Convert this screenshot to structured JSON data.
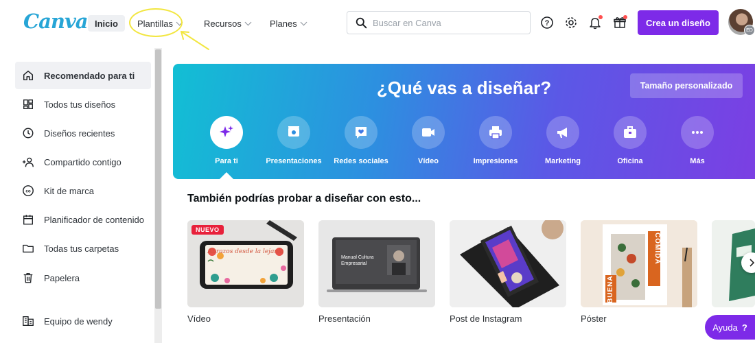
{
  "header": {
    "logo": "Canva",
    "nav": [
      {
        "label": "Inicio"
      },
      {
        "label": "Plantillas"
      },
      {
        "label": "Recursos"
      },
      {
        "label": "Planes"
      }
    ],
    "search_placeholder": "Buscar en Canva",
    "create_label": "Crea un diseño",
    "avatar_initials": "ED",
    "icons": [
      "help-icon",
      "settings-icon",
      "notification-bell-icon",
      "gift-icon"
    ]
  },
  "sidebar": {
    "items": [
      {
        "label": "Recomendado para ti",
        "icon": "home-icon"
      },
      {
        "label": "Todos tus diseños",
        "icon": "grid-icon"
      },
      {
        "label": "Diseños recientes",
        "icon": "clock-icon"
      },
      {
        "label": "Compartido contigo",
        "icon": "shared-users-icon"
      },
      {
        "label": "Kit de marca",
        "icon": "brand-kit-icon"
      },
      {
        "label": "Planificador de contenido",
        "icon": "calendar-icon"
      },
      {
        "label": "Todas tus carpetas",
        "icon": "folder-icon"
      },
      {
        "label": "Papelera",
        "icon": "trash-icon"
      },
      {
        "label": "Equipo de wendy",
        "icon": "team-icon"
      }
    ]
  },
  "hero": {
    "title": "¿Qué vas a diseñar?",
    "custom_size": "Tamaño personalizado",
    "categories": [
      {
        "label": "Para ti",
        "icon": "sparkle-icon"
      },
      {
        "label": "Presentaciones",
        "icon": "presentation-icon"
      },
      {
        "label": "Redes sociales",
        "icon": "heart-chat-icon"
      },
      {
        "label": "Vídeo",
        "icon": "video-camera-icon"
      },
      {
        "label": "Impresiones",
        "icon": "printer-icon"
      },
      {
        "label": "Marketing",
        "icon": "megaphone-icon"
      },
      {
        "label": "Oficina",
        "icon": "briefcase-icon"
      },
      {
        "label": "Más",
        "icon": "more-dots-icon"
      }
    ]
  },
  "suggestions": {
    "title": "También podrías probar a diseñar con esto...",
    "badge": "NUEVO",
    "thumb_texts": {
      "video": "Abrazos desde la lejanía",
      "presentation": "Manual Cultura Empresarial",
      "poster_a": "COMIDA",
      "poster_b": "BUENA"
    },
    "cards": [
      {
        "label": "Vídeo"
      },
      {
        "label": "Presentación"
      },
      {
        "label": "Post de Instagram"
      },
      {
        "label": "Póster"
      }
    ]
  },
  "help": {
    "label": "Ayuda",
    "mark": "?"
  },
  "colors": {
    "brand_purple": "#7d2ae8",
    "logo_blue": "#27a5d6",
    "annotation_yellow": "#f2e640"
  }
}
